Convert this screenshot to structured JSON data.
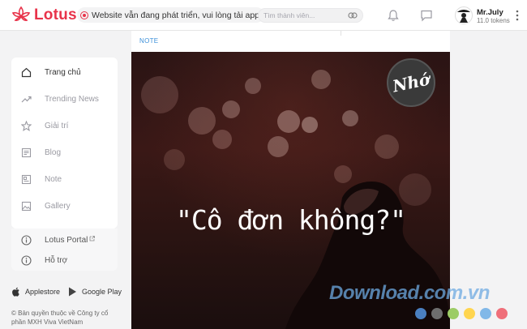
{
  "header": {
    "logo_text": "Lotus",
    "notice_text": "Website vẫn đang phát triển, vui lòng tải app",
    "search_placeholder": "Tìm thành viên...",
    "user": {
      "name": "Mr.July",
      "tokens": "11.0 tokens"
    }
  },
  "sidebar": {
    "items": [
      {
        "label": "Trang chủ",
        "icon": "home-icon",
        "active": true
      },
      {
        "label": "Trending News",
        "icon": "trending-icon"
      },
      {
        "label": "Giải trí",
        "icon": "star-icon"
      },
      {
        "label": "Blog",
        "icon": "blog-icon"
      },
      {
        "label": "Note",
        "icon": "note-icon"
      },
      {
        "label": "Gallery",
        "icon": "gallery-icon"
      }
    ],
    "secondary": [
      {
        "label": "Lotus Portal",
        "icon": "info-icon"
      },
      {
        "label": "Hỗ trợ",
        "icon": "info-icon"
      }
    ],
    "stores": {
      "apple": "Applestore",
      "google": "Google Play"
    },
    "copyright": "© Bản quyền thuộc về Công ty cổ phần MXH Viva VietNam"
  },
  "post": {
    "category": "NOTE",
    "quote": "\"Cô đơn không?\"",
    "badge_text": "Nhớ"
  },
  "watermark": {
    "text": "Download.com.vn",
    "dot_colors": [
      "#4a7fc0",
      "#6e6e6e",
      "#9ccc65",
      "#ffd54f",
      "#81b8e8",
      "#ef6f7a"
    ]
  },
  "colors": {
    "brand": "#e8334a",
    "link": "#3b8fd9"
  }
}
